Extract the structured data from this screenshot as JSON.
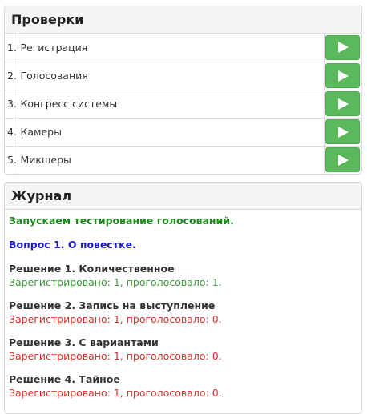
{
  "checks": {
    "title": "Проверки",
    "items": [
      {
        "num": "1.",
        "name": "Регистрация"
      },
      {
        "num": "2.",
        "name": "Голосования"
      },
      {
        "num": "3.",
        "name": "Конгресс системы"
      },
      {
        "num": "4.",
        "name": "Камеры"
      },
      {
        "num": "5.",
        "name": "Микшеры"
      }
    ],
    "run_icon": "play-icon",
    "button_color": "#5cb85c"
  },
  "journal": {
    "title": "Журнал",
    "start_message": "Запускаем тестирование голосований.",
    "question": "Вопрос 1. О повестке.",
    "entries": [
      {
        "title": "Решение 1. Количественное",
        "result": "Зарегистрировано: 1, проголосовало: 1.",
        "status": "success"
      },
      {
        "title": "Решение 2. Запись на выступление",
        "result": "Зарегистрировано: 1, проголосовало: 0.",
        "status": "error"
      },
      {
        "title": "Решение 3. С вариантами",
        "result": "Зарегистрировано: 1, проголосовало: 0.",
        "status": "error"
      },
      {
        "title": "Решение 4. Тайное",
        "result": "Зарегистрировано: 1, проголосовало: 0.",
        "status": "error"
      }
    ],
    "colors": {
      "success": "#3a9b3a",
      "error": "#d9312a",
      "info": "#1a1acc",
      "start": "#1a8a1a"
    }
  }
}
